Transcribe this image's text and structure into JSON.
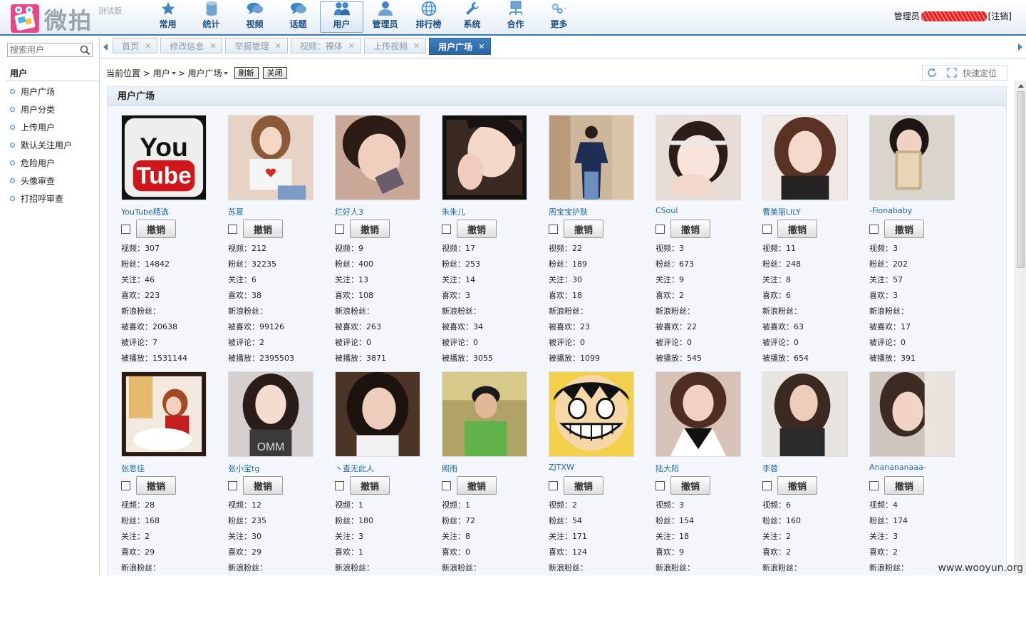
{
  "app": {
    "logo_text": "微拍",
    "logo_sub": "测试版",
    "admin_label": "管理员",
    "logout": "[注销]"
  },
  "nav": [
    {
      "label": "常用",
      "icon": "star-icon"
    },
    {
      "label": "统计",
      "icon": "database-icon"
    },
    {
      "label": "视频",
      "icon": "chat-bubble-icon"
    },
    {
      "label": "话题",
      "icon": "chat-bubble-icon"
    },
    {
      "label": "用户",
      "icon": "users-icon",
      "active": true
    },
    {
      "label": "管理员",
      "icon": "person-icon"
    },
    {
      "label": "排行榜",
      "icon": "globe-icon"
    },
    {
      "label": "系统",
      "icon": "wrench-icon"
    },
    {
      "label": "合作",
      "icon": "network-icon"
    },
    {
      "label": "更多",
      "icon": "gears-icon"
    }
  ],
  "sidebar": {
    "search_placeholder": "搜索用户",
    "title": "用户",
    "items": [
      "用户广场",
      "用户分类",
      "上传用户",
      "默认关注用户",
      "危险用户",
      "头像审查",
      "打招呼审查"
    ]
  },
  "tabs": [
    {
      "label": "首页"
    },
    {
      "label": "修改信息"
    },
    {
      "label": "举报管理"
    },
    {
      "label": "视频：裸体"
    },
    {
      "label": "上传视频"
    },
    {
      "label": "用户广场",
      "active": true
    }
  ],
  "breadcrumb": {
    "prefix": "当前位置",
    "path1": "用户",
    "path2": "用户广场",
    "refresh": "刷新",
    "close": "关闭",
    "quick": "快速定位"
  },
  "panel": {
    "title": "用户广场",
    "revoke_label": "撤销"
  },
  "stat_labels": {
    "videos": "视频：",
    "fans": "粉丝：",
    "follows": "关注：",
    "likes": "喜欢：",
    "sina": "新浪粉丝：",
    "liked": "被喜欢：",
    "comments": "被评论：",
    "plays": "被播放："
  },
  "users": [
    {
      "name": "YouTube精选",
      "videos": "307",
      "fans": "14842",
      "follows": "46",
      "likes": "223",
      "sina": "",
      "liked": "20638",
      "comments": "7",
      "plays": "1531144"
    },
    {
      "name": "苏夏",
      "videos": "212",
      "fans": "32235",
      "follows": "6",
      "likes": "38",
      "sina": "",
      "liked": "99126",
      "comments": "2",
      "plays": "2395503"
    },
    {
      "name": "烂好人3",
      "videos": "9",
      "fans": "400",
      "follows": "13",
      "likes": "108",
      "sina": "",
      "liked": "263",
      "comments": "0",
      "plays": "3871"
    },
    {
      "name": "朱朱儿",
      "videos": "17",
      "fans": "253",
      "follows": "14",
      "likes": "3",
      "sina": "",
      "liked": "34",
      "comments": "0",
      "plays": "3055"
    },
    {
      "name": "周宝宝护肤",
      "videos": "22",
      "fans": "189",
      "follows": "30",
      "likes": "18",
      "sina": "",
      "liked": "23",
      "comments": "0",
      "plays": "1099"
    },
    {
      "name": "CSoul",
      "videos": "3",
      "fans": "673",
      "follows": "9",
      "likes": "2",
      "sina": "",
      "liked": "22",
      "comments": "0",
      "plays": "545"
    },
    {
      "name": "曹美丽LILY",
      "videos": "11",
      "fans": "248",
      "follows": "8",
      "likes": "6",
      "sina": "",
      "liked": "63",
      "comments": "0",
      "plays": "654"
    },
    {
      "name": "-Fionababy",
      "videos": "3",
      "fans": "202",
      "follows": "57",
      "likes": "3",
      "sina": "",
      "liked": "17",
      "comments": "0",
      "plays": "391"
    },
    {
      "name": "张思佳",
      "videos": "28",
      "fans": "168",
      "follows": "2",
      "likes": "29",
      "sina": ""
    },
    {
      "name": "张小宝tg",
      "videos": "12",
      "fans": "235",
      "follows": "30",
      "likes": "29",
      "sina": ""
    },
    {
      "name": "丶查无此人",
      "videos": "1",
      "fans": "180",
      "follows": "3",
      "likes": "1",
      "sina": ""
    },
    {
      "name": "照雨",
      "videos": "1",
      "fans": "72",
      "follows": "8",
      "likes": "0",
      "sina": ""
    },
    {
      "name": "ZJTXW",
      "videos": "2",
      "fans": "54",
      "follows": "171",
      "likes": "124",
      "sina": ""
    },
    {
      "name": "陆大阳",
      "videos": "3",
      "fans": "154",
      "follows": "18",
      "likes": "9",
      "sina": ""
    },
    {
      "name": "李蓉",
      "videos": "6",
      "fans": "160",
      "follows": "2",
      "likes": "2",
      "sina": ""
    },
    {
      "name": "Ananananaaa-",
      "videos": "4",
      "fans": "174",
      "follows": "3",
      "likes": "2",
      "sina": ""
    }
  ],
  "watermark": "www.wooyun.org",
  "colors": {
    "accent": "#2a64a2",
    "link": "#1b67a6",
    "nav_text": "#1b4f86"
  }
}
